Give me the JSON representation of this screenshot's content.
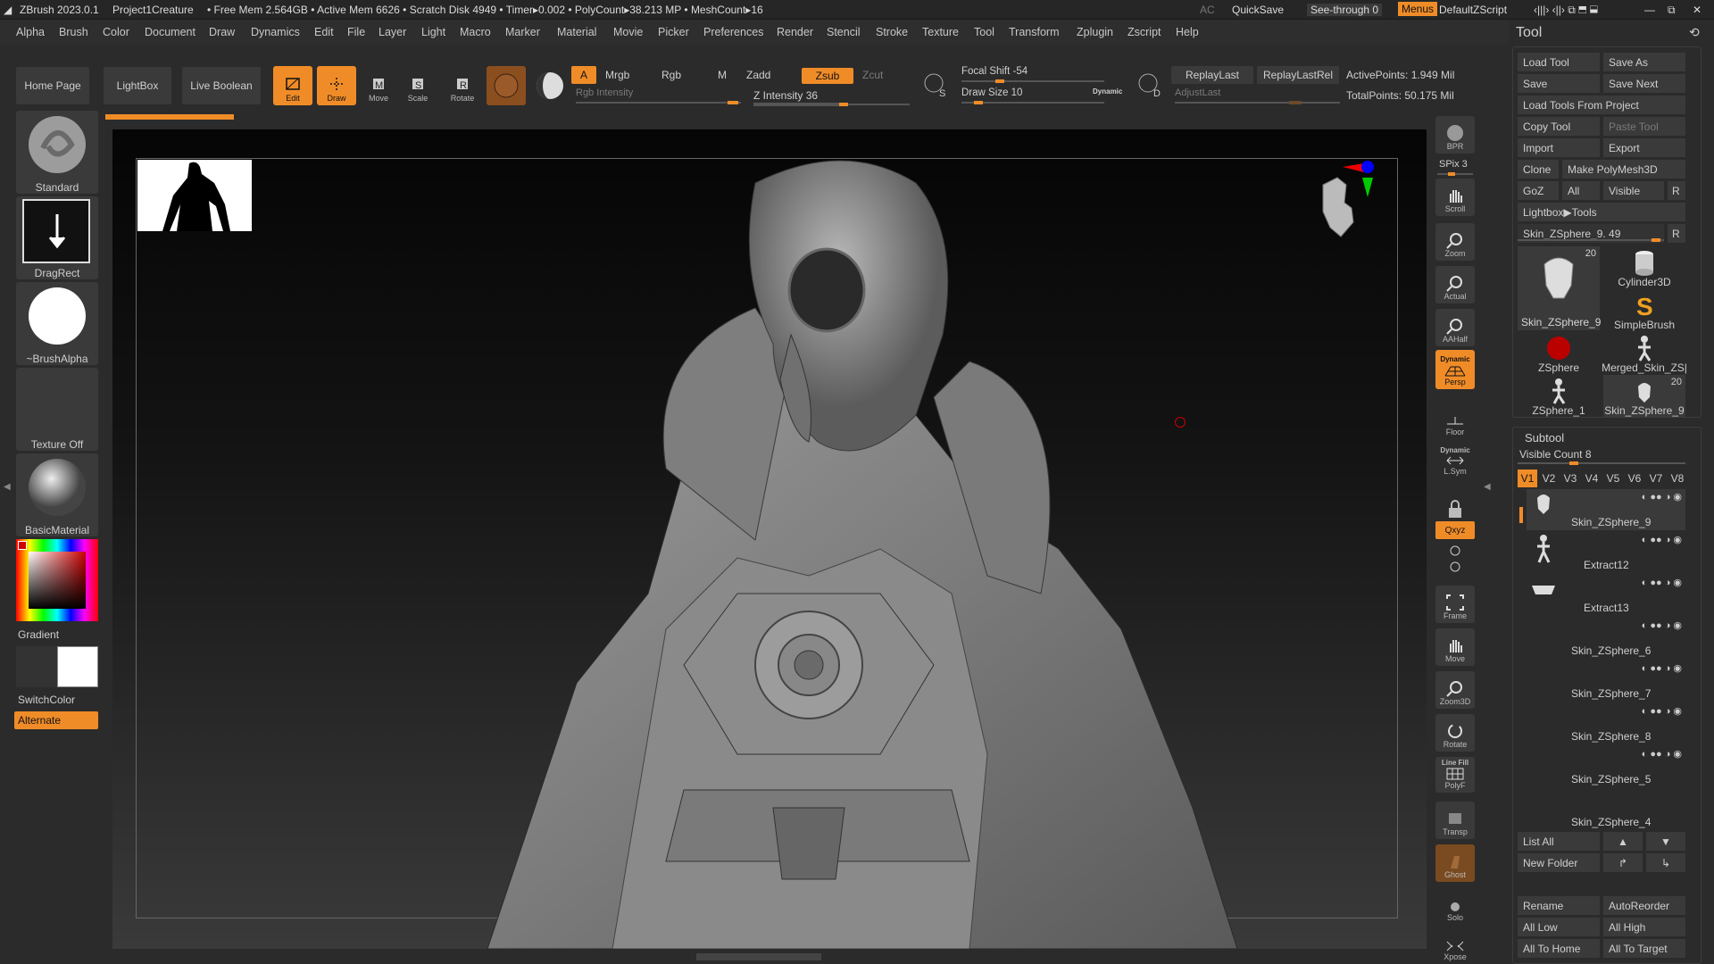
{
  "titlebar": {
    "app": "ZBrush 2023.0.1",
    "project": "Project1Creature",
    "stats": "• Free Mem 2.564GB • Active Mem 6626 • Scratch Disk 4949 • Timer▸0.002 • PolyCount▸38.213 MP • MeshCount▸16",
    "ac": "AC",
    "quicksave": "QuickSave",
    "seethrough": "See-through  0",
    "menus": "Menus",
    "script": "DefaultZScript"
  },
  "menu": [
    "Alpha",
    "Brush",
    "Color",
    "Document",
    "Draw",
    "Dynamics",
    "Edit",
    "File",
    "Layer",
    "Light",
    "Macro",
    "Marker",
    "Material",
    "Movie",
    "Picker",
    "Preferences",
    "Render",
    "Stencil",
    "Stroke",
    "Texture",
    "Tool",
    "Transform",
    "Zplugin",
    "Zscript",
    "Help"
  ],
  "topbar": {
    "home": "Home Page",
    "lightbox": "LightBox",
    "liveboolean": "Live Boolean",
    "edit": "Edit",
    "draw": "Draw",
    "move": "Move",
    "scale": "Scale",
    "rotate": "Rotate",
    "a": "A",
    "mrgb": "Mrgb",
    "rgb": "Rgb",
    "m": "M",
    "zadd": "Zadd",
    "zsub": "Zsub",
    "zcut": "Zcut",
    "rgb_intensity": "Rgb Intensity",
    "z_intensity": "Z Intensity 36",
    "focal_shift": "Focal Shift -54",
    "draw_size": "Draw Size 10",
    "dynamic": "Dynamic",
    "replaylast": "ReplayLast",
    "replaylastrel": "ReplayLastRel",
    "adjustlast": "AdjustLast",
    "activepoints": "ActivePoints: 1.949 Mil",
    "totalpoints": "TotalPoints: 50.175 Mil",
    "s": "S",
    "d": "D"
  },
  "left": {
    "standard": "Standard",
    "dragrect": "DragRect",
    "brushalpha": "~BrushAlpha",
    "textureoff": "Texture Off",
    "basicmaterial": "BasicMaterial",
    "gradient": "Gradient",
    "switchcolor": "SwitchColor",
    "alternate": "Alternate"
  },
  "right": {
    "bpr": "BPR",
    "spix": "SPix 3",
    "scroll": "Scroll",
    "zoom": "Zoom",
    "actual": "Actual",
    "aahalf": "AAHalf",
    "dynamic": "Dynamic",
    "persp": "Persp",
    "floor": "Floor",
    "lsym": "L.Sym",
    "xyz": "Qxyz",
    "frame": "Frame",
    "move": "Move",
    "zoom3d": "Zoom3D",
    "rotate": "Rotate",
    "linefill": "Line Fill",
    "polyf": "PolyF",
    "transp": "Transp",
    "ghost": "Ghost",
    "dynamic2": "Dynamic",
    "solo": "Solo",
    "xpose": "Xpose"
  },
  "tool": {
    "title": "Tool",
    "load": "Load Tool",
    "saveas": "Save As",
    "save": "Save",
    "savenext": "Save Next",
    "loadproj": "Load Tools From Project",
    "copy": "Copy Tool",
    "paste": "Paste Tool",
    "import": "Import",
    "export": "Export",
    "clone": "Clone",
    "makepoly": "Make PolyMesh3D",
    "goz": "GoZ",
    "all": "All",
    "visible": "Visible",
    "r": "R",
    "lightbox": "Lightbox▶Tools",
    "current": "Skin_ZSphere_9. 49",
    "thumbs": [
      {
        "name": "Skin_ZSphere_9",
        "badge": "20"
      },
      {
        "name": "Cylinder3D",
        "badge": ""
      },
      {
        "name": "SimpleBrush",
        "badge": ""
      },
      {
        "name": "ZSphere",
        "badge": ""
      },
      {
        "name": "Merged_Skin_ZS|",
        "badge": ""
      },
      {
        "name": "ZSphere_1",
        "badge": ""
      },
      {
        "name": "Skin_ZSphere_9",
        "badge": "20"
      }
    ]
  },
  "subtool": {
    "title": "Subtool",
    "count": "Visible Count 8",
    "versions": [
      "V1",
      "V2",
      "V3",
      "V4",
      "V5",
      "V6",
      "V7",
      "V8"
    ],
    "items": [
      "Skin_ZSphere_9",
      "Extract12",
      "Extract13",
      "Skin_ZSphere_6",
      "Skin_ZSphere_7",
      "Skin_ZSphere_8",
      "Skin_ZSphere_5",
      "Skin_ZSphere_4"
    ],
    "listall": "List All",
    "newfolder": "New Folder",
    "rename": "Rename",
    "autoreorder": "AutoReorder",
    "alllow": "All Low",
    "allhigh": "All High",
    "alltohome": "All To Home",
    "alltotarget": "All To Target"
  }
}
